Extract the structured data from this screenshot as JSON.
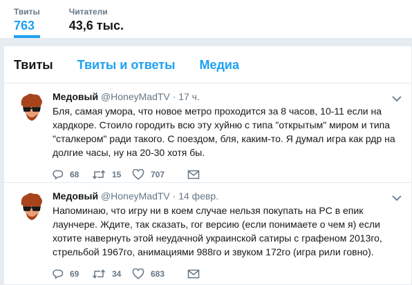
{
  "stats": {
    "tweets": {
      "label": "Твиты",
      "value": "763"
    },
    "followers": {
      "label": "Читатели",
      "value": "43,6 тыс."
    }
  },
  "tabs": [
    {
      "label": "Твиты",
      "active": true
    },
    {
      "label": "Твиты и ответы",
      "active": false
    },
    {
      "label": "Медиа",
      "active": false
    }
  ],
  "tweets": [
    {
      "fullname": "Медовый",
      "username": "@HoneyMadTV",
      "sep": "·",
      "time": "17 ч.",
      "text": "Бля, самая умора, что новое метро проходится за 8 часов, 10-11 если на хардкоре. Стоило городить всю эту хуйню с типа \"открытым\" миром и типа \"сталкером\" ради такого. С поездом, бля, каким-то. Я думал игра как рдр на долгие часы, ну на 20-30 хотя бы.",
      "replies": "68",
      "retweets": "15",
      "likes": "707"
    },
    {
      "fullname": "Медовый",
      "username": "@HoneyMadTV",
      "sep": "·",
      "time": "14 февр.",
      "text": "Напоминаю, что игру ни в коем случае нельзя покупать на PC в епик лаунчере. Ждите, так сказать, гог версию (если понимаете о чем я) если хотите навернуть этой неудачной украинской сатиры с графеном 2013го, стрельбой 1967го, анимациями 988го и звуком 172го (игра рили говно).",
      "replies": "69",
      "retweets": "34",
      "likes": "683"
    }
  ],
  "colors": {
    "accent": "#1da1f2",
    "muted": "#657786",
    "text": "#14171a",
    "background": "#e6ecf0"
  },
  "icons": {
    "reply": "reply-icon",
    "retweet": "retweet-icon",
    "like": "heart-icon",
    "dm": "envelope-icon",
    "caret": "chevron-down-icon"
  }
}
